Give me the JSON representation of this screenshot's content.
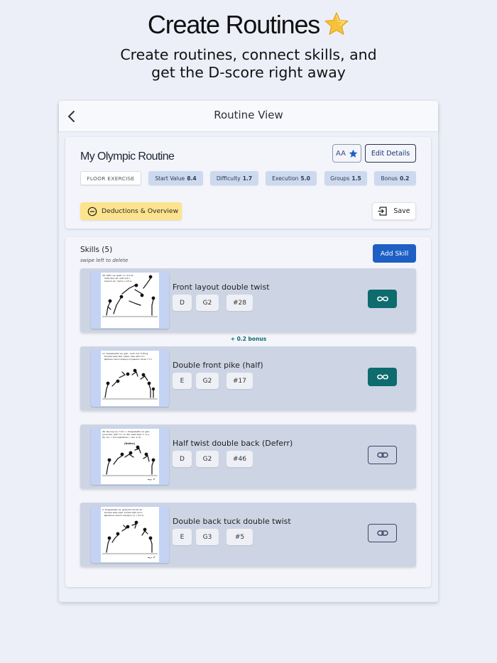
{
  "hero": {
    "title": "Create Routines",
    "subtitle_line1": "Create routines, connect skills, and",
    "subtitle_line2": "get the D-score right away",
    "title_icon": "star-emoji"
  },
  "topbar": {
    "title": "Routine View",
    "back_icon": "chevron-left-icon"
  },
  "routine": {
    "name": "My Olympic Routine",
    "aa_label": "AA",
    "edit_label": "Edit Details",
    "event": "FLOOR EXERCISE",
    "stats": [
      {
        "label": "Start Value",
        "value": "8.4"
      },
      {
        "label": "Difficulty",
        "value": "1.7"
      },
      {
        "label": "Execution",
        "value": "5.0"
      },
      {
        "label": "Groups",
        "value": "1.5"
      },
      {
        "label": "Bonus",
        "value": "0.2"
      }
    ],
    "deductions_label": "Deductions & Overview",
    "save_label": "Save"
  },
  "skills": {
    "title": "Skills (5)",
    "hint": "swipe left to delete",
    "add_label": "Add Skill",
    "bonus_text": "+ 0.2 bonus",
    "items": [
      {
        "name": "Front layout double twist",
        "value": "D",
        "group": "G2",
        "number": "#28",
        "connected": true,
        "caption": [
          "28. Salto vw. gestr. m. 2/1 Dr.",
          "Salto fwd. str. with 2/1 t.",
          "Сальто вп. прогн.с 2/1 в."
        ]
      },
      {
        "name": "Double front pike (half)",
        "value": "E",
        "group": "G2",
        "number": "#17",
        "connected": true,
        "caption": [
          "17. Doppelsalto vw. geb., auch mit ½ Drhg.",
          "Double salto fwd. piked, also with ½ t.",
          "Двойное сальто вперед согнувшись также с ½ п."
        ]
      },
      {
        "name": "Half twist double back (Deferr)",
        "value": "D",
        "group": "G2",
        "number": "#46",
        "connected": false,
        "caption": [
          "46. Sprung vw. ½ Dr. u. Doppelsalto rw. geh.",
          "Jump fwd. with ½ t. to dbl. salto bwd. t. or p.",
          "Пр. вп. с 1/2 в.двойное с. нaз. в гр."
        ],
        "label": "(Deferr)"
      },
      {
        "name": "Double back tuck double twist",
        "value": "E",
        "group": "G3",
        "number": "#5",
        "connected": false,
        "caption": [
          "5. Doppelsalto rw. gehockt mit 2/1 Dr.",
          "Double salto bwd. tucked with 2/1 t.",
          "Двойное сальто назад в гр. с 2/1 в."
        ]
      }
    ]
  },
  "colors": {
    "accent": "#1d5fc4",
    "teal": "#0e6b6e",
    "chip": "#cdd9ee",
    "deductions": "#fde38d",
    "background": "#eceff8"
  }
}
